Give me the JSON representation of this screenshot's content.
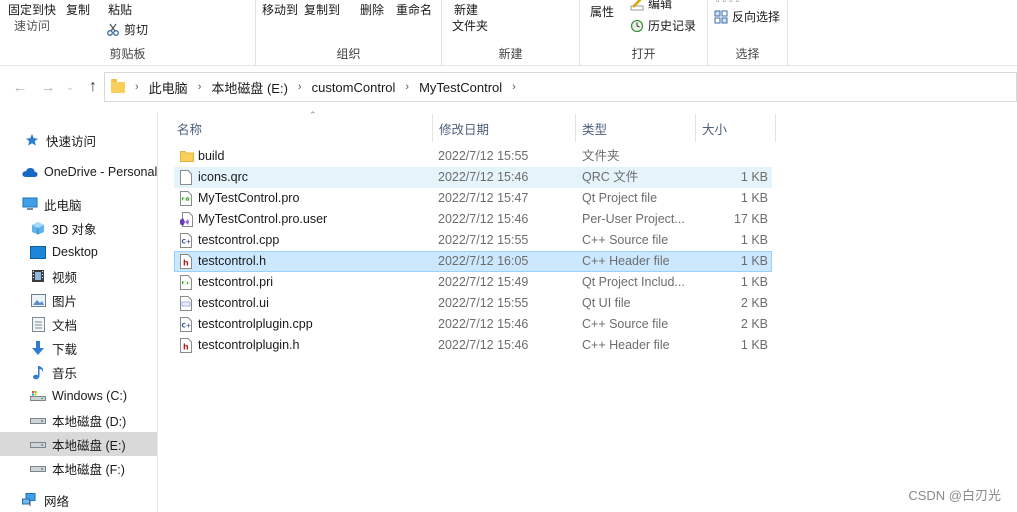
{
  "ribbon": {
    "clipboard": {
      "pin_label_1": "固定到快",
      "pin_label_2": "速访问",
      "copy": "复制",
      "paste": "粘贴",
      "cut": "剪切",
      "group": "剪贴板"
    },
    "organize": {
      "move_to": "移动到",
      "copy_to": "复制到",
      "delete": "删除",
      "rename": "重命名",
      "group": "组织"
    },
    "new": {
      "new_folder_1": "新建",
      "new_folder_2": "文件夹",
      "group": "新建"
    },
    "open": {
      "properties": "属性",
      "edit": "编辑",
      "history": "历史记录",
      "group": "打开"
    },
    "select": {
      "invert": "反向选择",
      "group": "选择"
    }
  },
  "address": {
    "crumbs": [
      "此电脑",
      "本地磁盘 (E:)",
      "customControl",
      "MyTestControl"
    ]
  },
  "sidebar": {
    "items": [
      {
        "label": "快速访问",
        "icon": "star-icon"
      },
      {
        "label": "OneDrive - Personal",
        "icon": "cloud-icon"
      },
      {
        "label": "此电脑",
        "icon": "computer-icon"
      },
      {
        "label": "3D 对象",
        "icon": "cube-icon"
      },
      {
        "label": "Desktop",
        "icon": "desktop-icon"
      },
      {
        "label": "视频",
        "icon": "video-icon"
      },
      {
        "label": "图片",
        "icon": "picture-icon"
      },
      {
        "label": "文档",
        "icon": "document-icon"
      },
      {
        "label": "下载",
        "icon": "download-icon"
      },
      {
        "label": "音乐",
        "icon": "music-icon"
      },
      {
        "label": "Windows (C:)",
        "icon": "drive-icon"
      },
      {
        "label": "本地磁盘 (D:)",
        "icon": "drive-icon"
      },
      {
        "label": "本地磁盘 (E:)",
        "icon": "drive-icon",
        "selected": true
      },
      {
        "label": "本地磁盘 (F:)",
        "icon": "drive-icon"
      },
      {
        "label": "网络",
        "icon": "network-icon"
      }
    ]
  },
  "columns": {
    "name": "名称",
    "date": "修改日期",
    "type": "类型",
    "size": "大小"
  },
  "files": [
    {
      "name": "build",
      "date": "2022/7/12 15:55",
      "type": "文件夹",
      "size": "",
      "icon": "folder-icon"
    },
    {
      "name": "icons.qrc",
      "date": "2022/7/12 15:46",
      "type": "QRC 文件",
      "size": "1 KB",
      "icon": "file-icon",
      "state": "hover"
    },
    {
      "name": "MyTestControl.pro",
      "date": "2022/7/12 15:47",
      "type": "Qt Project file",
      "size": "1 KB",
      "icon": "pro-file-icon"
    },
    {
      "name": "MyTestControl.pro.user",
      "date": "2022/7/12 15:46",
      "type": "Per-User Project...",
      "size": "17 KB",
      "icon": "user-file-icon"
    },
    {
      "name": "testcontrol.cpp",
      "date": "2022/7/12 15:55",
      "type": "C++ Source file",
      "size": "1 KB",
      "icon": "cpp-file-icon"
    },
    {
      "name": "testcontrol.h",
      "date": "2022/7/12 16:05",
      "type": "C++ Header file",
      "size": "1 KB",
      "icon": "header-file-icon",
      "state": "selected"
    },
    {
      "name": "testcontrol.pri",
      "date": "2022/7/12 15:49",
      "type": "Qt Project Includ...",
      "size": "1 KB",
      "icon": "pri-file-icon"
    },
    {
      "name": "testcontrol.ui",
      "date": "2022/7/12 15:55",
      "type": "Qt UI file",
      "size": "2 KB",
      "icon": "ui-file-icon"
    },
    {
      "name": "testcontrolplugin.cpp",
      "date": "2022/7/12 15:46",
      "type": "C++ Source file",
      "size": "2 KB",
      "icon": "cpp-file-icon"
    },
    {
      "name": "testcontrolplugin.h",
      "date": "2022/7/12 15:46",
      "type": "C++ Header file",
      "size": "1 KB",
      "icon": "header-file-icon"
    }
  ],
  "watermark": "CSDN @白刃光",
  "colors": {
    "selected_bg": "#cce8ff",
    "hover_bg": "#e5f3fb",
    "folder": "#f7cf5a",
    "header_text": "#4c607a"
  }
}
